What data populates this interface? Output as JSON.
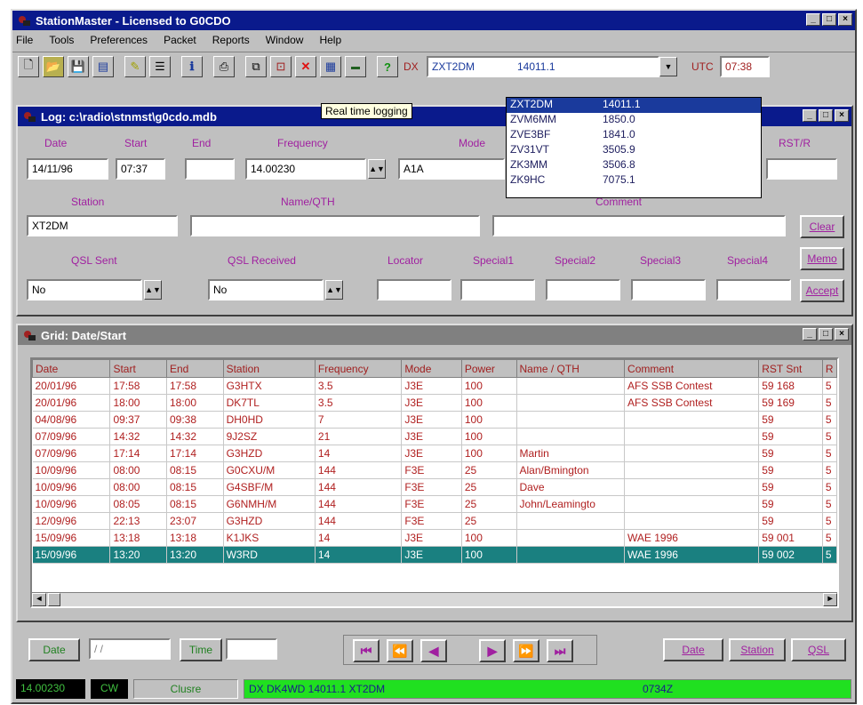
{
  "app": {
    "title": "StationMaster - Licensed to G0CDO"
  },
  "menu": [
    "File",
    "Tools",
    "Preferences",
    "Packet",
    "Reports",
    "Window",
    "Help"
  ],
  "toolbar": {
    "dx_label": "DX",
    "dx_value": "ZXT2DM",
    "dx_freq": "14011.1",
    "utc_label": "UTC",
    "utc_value": "07:38",
    "tooltip": "Real time logging"
  },
  "dx_dropdown": [
    {
      "call": "ZXT2DM",
      "freq": "14011.1"
    },
    {
      "call": "ZVM6MM",
      "freq": "1850.0"
    },
    {
      "call": "ZVE3BF",
      "freq": "1841.0"
    },
    {
      "call": "ZV31VT",
      "freq": "3505.9"
    },
    {
      "call": "ZK3MM",
      "freq": "3506.8"
    },
    {
      "call": "ZK9HC",
      "freq": "7075.1"
    }
  ],
  "log": {
    "title": "Log: c:\\radio\\stnmst\\g0cdo.mdb",
    "labels": {
      "date": "Date",
      "start": "Start",
      "end": "End",
      "frequency": "Frequency",
      "mode": "Mode",
      "rst_r": "RST/R",
      "station": "Station",
      "name_qth": "Name/QTH",
      "comment": "Comment",
      "qsl_sent": "QSL Sent",
      "qsl_received": "QSL Received",
      "locator": "Locator",
      "special1": "Special1",
      "special2": "Special2",
      "special3": "Special3",
      "special4": "Special4"
    },
    "values": {
      "date": "14/11/96",
      "start": "07:37",
      "end": "",
      "frequency": "14.00230",
      "mode": "A1A",
      "station": "XT2DM",
      "qsl_sent": "No",
      "qsl_received": "No"
    },
    "buttons": {
      "clear": "Clear",
      "memo": "Memo",
      "accept": "Accept"
    }
  },
  "grid": {
    "title": "Grid: Date/Start",
    "columns": [
      "Date",
      "Start",
      "End",
      "Station",
      "Frequency",
      "Mode",
      "Power",
      "Name / QTH",
      "Comment",
      "RST Snt",
      "R"
    ],
    "rows": [
      [
        "20/01/96",
        "17:58",
        "17:58",
        "G3HTX",
        "3.5",
        "J3E",
        "100",
        "",
        "AFS SSB Contest",
        "59 168",
        "5"
      ],
      [
        "20/01/96",
        "18:00",
        "18:00",
        "DK7TL",
        "3.5",
        "J3E",
        "100",
        "",
        "AFS SSB Contest",
        "59 169",
        "5"
      ],
      [
        "04/08/96",
        "09:37",
        "09:38",
        "DH0HD",
        "7",
        "J3E",
        "100",
        "",
        "",
        "59",
        "5"
      ],
      [
        "07/09/96",
        "14:32",
        "14:32",
        "9J2SZ",
        "21",
        "J3E",
        "100",
        "",
        "",
        "59",
        "5"
      ],
      [
        "07/09/96",
        "17:14",
        "17:14",
        "G3HZD",
        "14",
        "J3E",
        "100",
        "Martin",
        "",
        "59",
        "5"
      ],
      [
        "10/09/96",
        "08:00",
        "08:15",
        "G0CXU/M",
        "144",
        "F3E",
        "25",
        "Alan/Bmington",
        "",
        "59",
        "5"
      ],
      [
        "10/09/96",
        "08:00",
        "08:15",
        "G4SBF/M",
        "144",
        "F3E",
        "25",
        "Dave",
        "",
        "59",
        "5"
      ],
      [
        "10/09/96",
        "08:05",
        "08:15",
        "G6NMH/M",
        "144",
        "F3E",
        "25",
        "John/Leamingto",
        "",
        "59",
        "5"
      ],
      [
        "12/09/96",
        "22:13",
        "23:07",
        "G3HZD",
        "144",
        "F3E",
        "25",
        "",
        "",
        "59",
        "5"
      ],
      [
        "15/09/96",
        "13:18",
        "13:18",
        "K1JKS",
        "14",
        "J3E",
        "100",
        "",
        "WAE 1996",
        "59 001",
        "5"
      ],
      [
        "15/09/96",
        "13:20",
        "13:20",
        "W3RD",
        "14",
        "J3E",
        "100",
        "",
        "WAE 1996",
        "59 002",
        "5"
      ]
    ],
    "selected_row": 10
  },
  "bottom": {
    "date_label": "Date",
    "date_value": "/ /",
    "time_label": "Time",
    "date_btn": "Date",
    "station_btn": "Station",
    "qsl_btn": "QSL"
  },
  "statusbar": {
    "freq": "14.00230",
    "mode": "CW",
    "state": "Clusre",
    "spot": "DX DK4WD   14011.1   XT2DM",
    "spot_time": "0734Z"
  }
}
